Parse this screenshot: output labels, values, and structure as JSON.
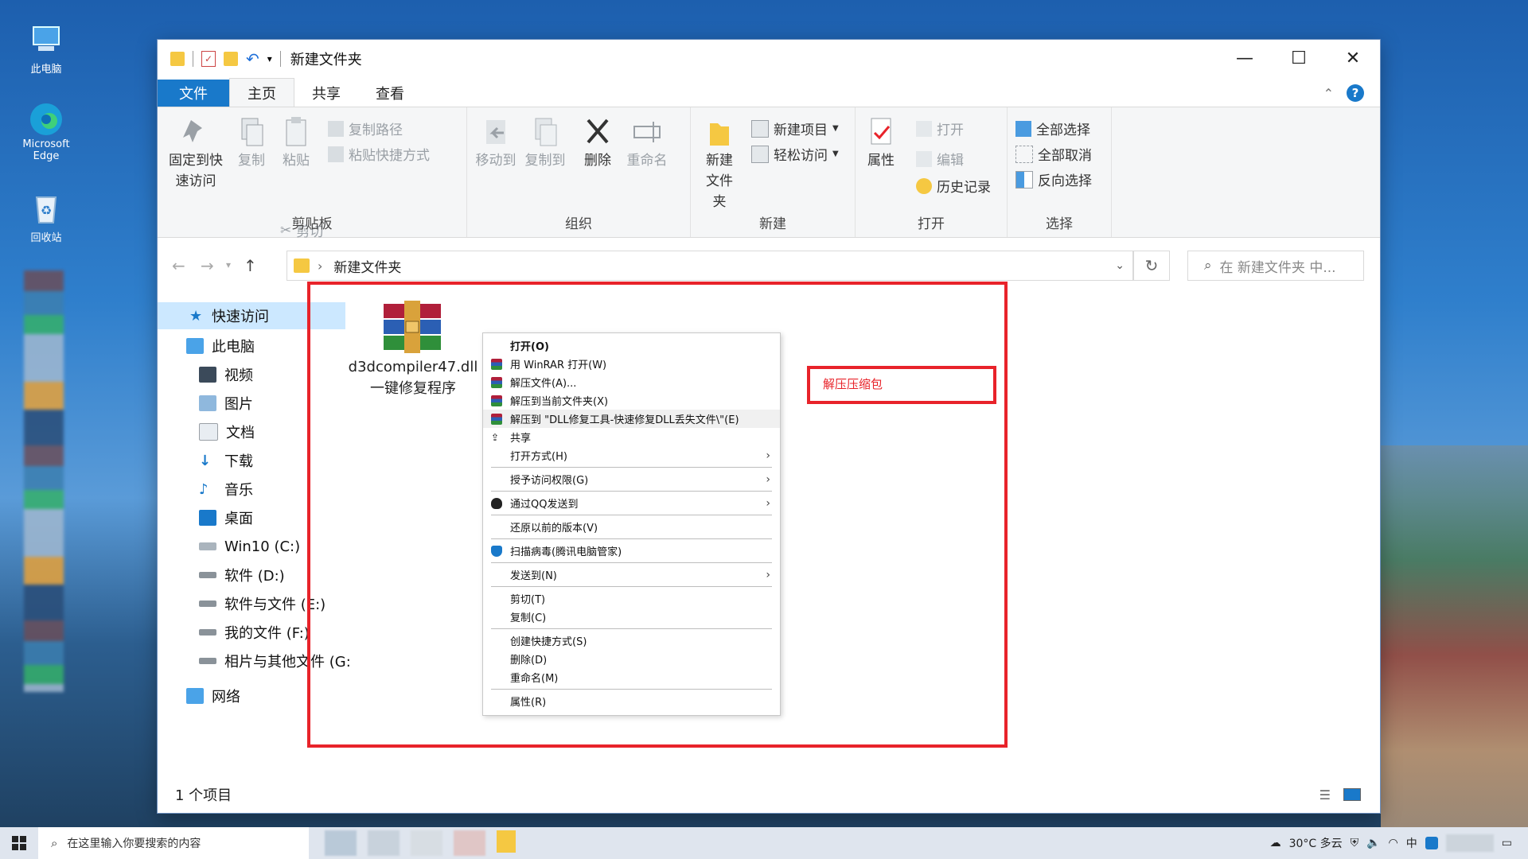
{
  "desktop": {
    "icons": [
      {
        "label": "此电脑",
        "icon": "computer-icon"
      },
      {
        "label": "Microsoft Edge",
        "icon": "edge-icon"
      },
      {
        "label": "回收站",
        "icon": "recycle-bin-icon"
      }
    ]
  },
  "window": {
    "title": "新建文件夹",
    "tabs": [
      "文件",
      "主页",
      "共享",
      "查看"
    ],
    "active_tab": "主页"
  },
  "ribbon": {
    "clipboard": {
      "pin_label": "固定到快速访问",
      "copy_label": "复制",
      "paste_label": "粘贴",
      "copy_path_label": "复制路径",
      "paste_shortcut_label": "粘贴快捷方式",
      "cut_label": "剪切",
      "group_label": "剪贴板"
    },
    "organize": {
      "move_to_label": "移动到",
      "copy_to_label": "复制到",
      "delete_label": "删除",
      "rename_label": "重命名",
      "group_label": "组织"
    },
    "new": {
      "new_folder_label": "新建文件夹",
      "new_item_label": "新建项目",
      "easy_access_label": "轻松访问",
      "group_label": "新建"
    },
    "open": {
      "properties_label": "属性",
      "open_label": "打开",
      "edit_label": "编辑",
      "history_label": "历史记录",
      "group_label": "打开"
    },
    "select": {
      "select_all_label": "全部选择",
      "select_none_label": "全部取消",
      "invert_label": "反向选择",
      "group_label": "选择"
    }
  },
  "address": {
    "crumb": "新建文件夹",
    "search_placeholder": "在 新建文件夹 中..."
  },
  "nav": {
    "quick_access": "快速访问",
    "this_pc": "此电脑",
    "items": [
      "视频",
      "图片",
      "文档",
      "下载",
      "音乐",
      "桌面",
      "Win10 (C:)",
      "软件 (D:)",
      "软件与文件 (E:)",
      "我的文件 (F:)",
      "相片与其他文件 (G:"
    ],
    "network": "网络"
  },
  "file": {
    "name_line1": "d3dcompiler47.dll",
    "name_line2": "一键修复程序"
  },
  "context_menu": {
    "items": [
      {
        "label": "打开(O)",
        "bold": true
      },
      {
        "label": "用 WinRAR 打开(W)"
      },
      {
        "label": "解压文件(A)..."
      },
      {
        "label": "解压到当前文件夹(X)"
      },
      {
        "label": "解压到 \"DLL修复工具-快速修复DLL丢失文件\\\"(E)"
      },
      {
        "label": "共享"
      },
      {
        "label": "打开方式(H)"
      },
      {
        "label": "授予访问权限(G)"
      },
      {
        "label": "通过QQ发送到"
      },
      {
        "label": "还原以前的版本(V)"
      },
      {
        "label": "扫描病毒(腾讯电脑管家)"
      },
      {
        "label": "发送到(N)"
      },
      {
        "label": "剪切(T)"
      },
      {
        "label": "复制(C)"
      },
      {
        "label": "创建快捷方式(S)"
      },
      {
        "label": "删除(D)"
      },
      {
        "label": "重命名(M)"
      },
      {
        "label": "属性(R)"
      }
    ]
  },
  "annotation": {
    "label": "解压压缩包",
    "color": "#e8232a"
  },
  "status": {
    "count": "1 个项目"
  },
  "taskbar": {
    "search_placeholder": "在这里输入你要搜索的内容",
    "weather": "30°C 多云"
  },
  "colors": {
    "accent": "#1979ca",
    "highlight_red": "#e8232a"
  }
}
